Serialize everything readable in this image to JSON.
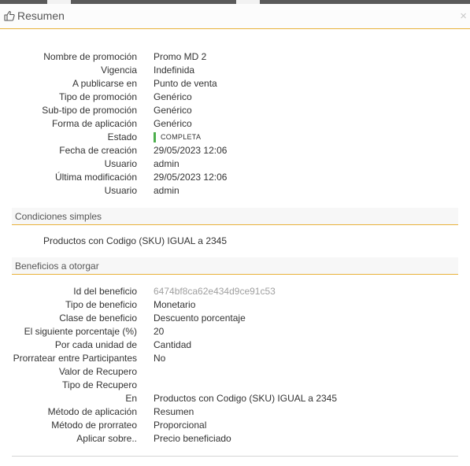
{
  "header": {
    "title": "Resumen",
    "close_label": "×"
  },
  "summary": [
    {
      "label": "Nombre de promoción",
      "value": "Promo MD 2"
    },
    {
      "label": "Vigencia",
      "value": "Indefinida"
    },
    {
      "label": "A publicarse en",
      "value": "Punto de venta"
    },
    {
      "label": "Tipo de promoción",
      "value": "Genérico"
    },
    {
      "label": "Sub-tipo de promoción",
      "value": "Genérico"
    },
    {
      "label": "Forma de aplicación",
      "value": "Genérico"
    },
    {
      "label": "Estado",
      "value": "COMPLETA"
    },
    {
      "label": "Fecha de creación",
      "value": "29/05/2023 12:06"
    },
    {
      "label": "Usuario",
      "value": "admin"
    },
    {
      "label": "Última modificación",
      "value": "29/05/2023 12:06"
    },
    {
      "label": "Usuario",
      "value": "admin"
    }
  ],
  "conditions": {
    "title": "Condiciones simples",
    "items": [
      "Productos con Codigo (SKU) IGUAL a 2345"
    ]
  },
  "benefits": {
    "title": "Beneficios a otorgar",
    "rows": [
      {
        "label": "Id del beneficio",
        "value": "6474bf8ca62e434d9ce91c53"
      },
      {
        "label": "Tipo de beneficio",
        "value": "Monetario"
      },
      {
        "label": "Clase de beneficio",
        "value": "Descuento porcentaje"
      },
      {
        "label": "El siguiente porcentaje (%)",
        "value": "20"
      },
      {
        "label": "Por cada unidad de",
        "value": "Cantidad"
      },
      {
        "label": "Prorratear entre Participantes",
        "value": "No"
      },
      {
        "label": "Valor de Recupero",
        "value": ""
      },
      {
        "label": "Tipo de Recupero",
        "value": ""
      },
      {
        "label": "En",
        "value": "Productos con Codigo (SKU) IGUAL a 2345"
      },
      {
        "label": "Método de aplicación",
        "value": "Resumen"
      },
      {
        "label": "Método de prorrateo",
        "value": "Proporcional"
      },
      {
        "label": "Aplicar sobre..",
        "value": "Precio beneficiado"
      }
    ]
  },
  "colors": {
    "accent": "#e8b23a",
    "status_complete": "#4cae4c",
    "muted_id": "#a0a0a0"
  },
  "icons": {
    "header": "thumbs-up-icon",
    "close": "close-icon"
  }
}
